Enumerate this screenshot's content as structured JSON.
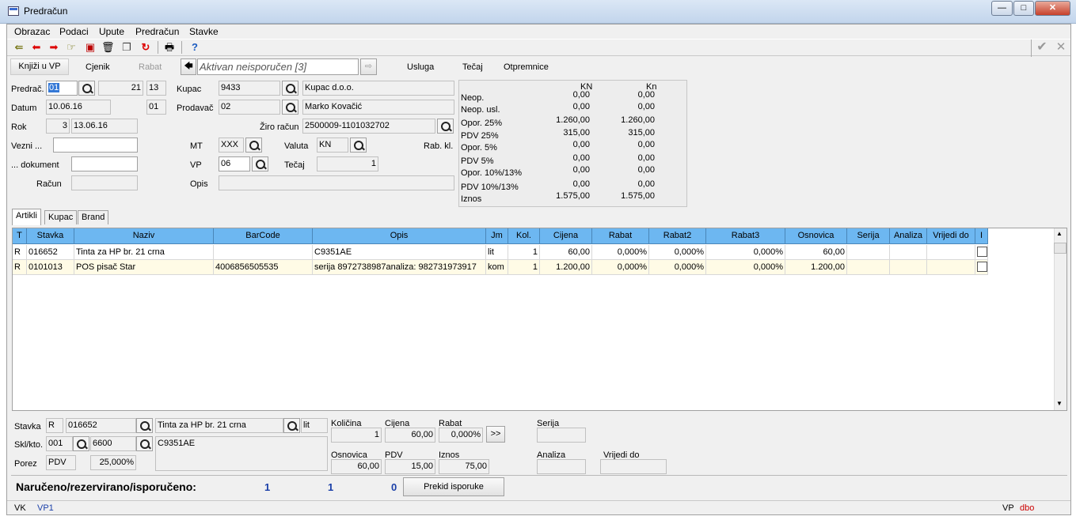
{
  "window": {
    "title": "Predračun",
    "min": "—",
    "max": "□",
    "close": "✕"
  },
  "menu": [
    "Obrazac",
    "Podaci",
    "Upute",
    "Predračun",
    "Stavke"
  ],
  "toolbar": {
    "help": "?",
    "confirm": "✔",
    "cancel": "✕"
  },
  "actions": {
    "knjizi": "Knjiži u VP",
    "cjenik": "Cjenik",
    "rabat": "Rabat",
    "status": "Aktivan neisporučen [3]",
    "usluga": "Usluga",
    "tecaj": "Tečaj",
    "otpremnice": "Otpremnice"
  },
  "header": {
    "predrac_label": "Predrač.",
    "predrac_value": "01",
    "predrac_num": "21",
    "predrac_num2": "13",
    "datum_label": "Datum",
    "datum_value": "10.06.16",
    "datum_code": "01",
    "rok_label": "Rok",
    "rok_days": "3",
    "rok_date": "13.06.16",
    "vezni_label": "Vezni ...",
    "dokument_label": "... dokument",
    "racun_label": "Račun",
    "kupac_label": "Kupac",
    "kupac_code": "9433",
    "kupac_name": "Kupac d.o.o.",
    "prodavac_label": "Prodavač",
    "prodavac_code": "02",
    "prodavac_name": "Marko Kovačić",
    "ziro_label": "Žiro račun",
    "ziro_value": "2500009-1101032702",
    "mt_label": "MT",
    "mt_value": "XXX",
    "valuta_label": "Valuta",
    "valuta_value": "KN",
    "rabkl_label": "Rab. kl.",
    "vp_label": "VP",
    "vp_value": "06",
    "tecaj_label": "Tečaj",
    "tecaj_value": "1",
    "opis_label": "Opis"
  },
  "summary": {
    "col1": "KN",
    "col2": "Kn",
    "rows": [
      {
        "label": "Neop.",
        "v1": "0,00",
        "v2": "0,00"
      },
      {
        "label": "Neop. usl.",
        "v1": "0,00",
        "v2": "0,00"
      },
      {
        "label": "Opor. 25%",
        "v1": "1.260,00",
        "v2": "1.260,00"
      },
      {
        "label": "PDV 25%",
        "v1": "315,00",
        "v2": "315,00"
      },
      {
        "label": "Opor. 5%",
        "v1": "0,00",
        "v2": "0,00"
      },
      {
        "label": "PDV 5%",
        "v1": "0,00",
        "v2": "0,00"
      },
      {
        "label": "Opor. 10%/13%",
        "v1": "0,00",
        "v2": "0,00"
      },
      {
        "label": "PDV 10%/13%",
        "v1": "0,00",
        "v2": "0,00"
      },
      {
        "label": "Iznos",
        "v1": "1.575,00",
        "v2": "1.575,00"
      }
    ]
  },
  "tabs": [
    "Artikli",
    "Kupac",
    "Brand"
  ],
  "grid": {
    "columns": [
      "T",
      "Stavka",
      "Naziv",
      "BarCode",
      "Opis",
      "Jm",
      "Kol.",
      "Cijena",
      "Rabat",
      "Rabat2",
      "Rabat3",
      "Osnovica",
      "Serija",
      "Analiza",
      "Vrijedi do",
      "I"
    ],
    "rows": [
      [
        "R",
        "016652",
        "Tinta za HP br. 21 crna",
        "",
        "C9351AE",
        "lit",
        "1",
        "60,00",
        "0,000%",
        "0,000%",
        "0,000%",
        "60,00",
        "",
        "",
        "",
        ""
      ],
      [
        "R",
        "0101013",
        "POS pisač Star",
        "4006856505535",
        "serija 8972738987analiza: 982731973917",
        "kom",
        "1",
        "1.200,00",
        "0,000%",
        "0,000%",
        "0,000%",
        "1.200,00",
        "",
        "",
        "",
        ""
      ]
    ]
  },
  "detail": {
    "stavka_label": "Stavka",
    "stavka_type": "R",
    "stavka_code": "016652",
    "stavka_name": "Tinta za HP br. 21 crna",
    "stavka_jm": "lit",
    "skl_label": "Skl/kto.",
    "skl_value": "001",
    "kto_value": "6600",
    "opis_value": "C9351AE",
    "porez_label": "Porez",
    "porez_value": "PDV",
    "porez_pct": "25,000%",
    "kolicina_label": "Količina",
    "kolicina_value": "1",
    "cijena_label": "Cijena",
    "cijena_value": "60,00",
    "rabat_label": "Rabat",
    "rabat_value": "0,000%",
    "more_btn": ">>",
    "osnovica_label": "Osnovica",
    "osnovica_value": "60,00",
    "pdv_label": "PDV",
    "pdv_value": "15,00",
    "iznos_label": "Iznos",
    "iznos_value": "75,00",
    "serija_label": "Serija",
    "analiza_label": "Analiza",
    "vrijedido_label": "Vrijedi do"
  },
  "bottom": {
    "label": "Naručeno/rezervirano/isporučeno:",
    "n1": "1",
    "n2": "1",
    "n3": "0",
    "prekid": "Prekid isporuke"
  },
  "status": {
    "vk": "VK",
    "vp1": "VP1",
    "vp": "VP",
    "db": "dbo"
  },
  "colors": {
    "header_blue": "#6db7f1",
    "selected_row": "#fffbe6",
    "status_red": "#cc0000",
    "status_blue": "#1a3fa8"
  }
}
